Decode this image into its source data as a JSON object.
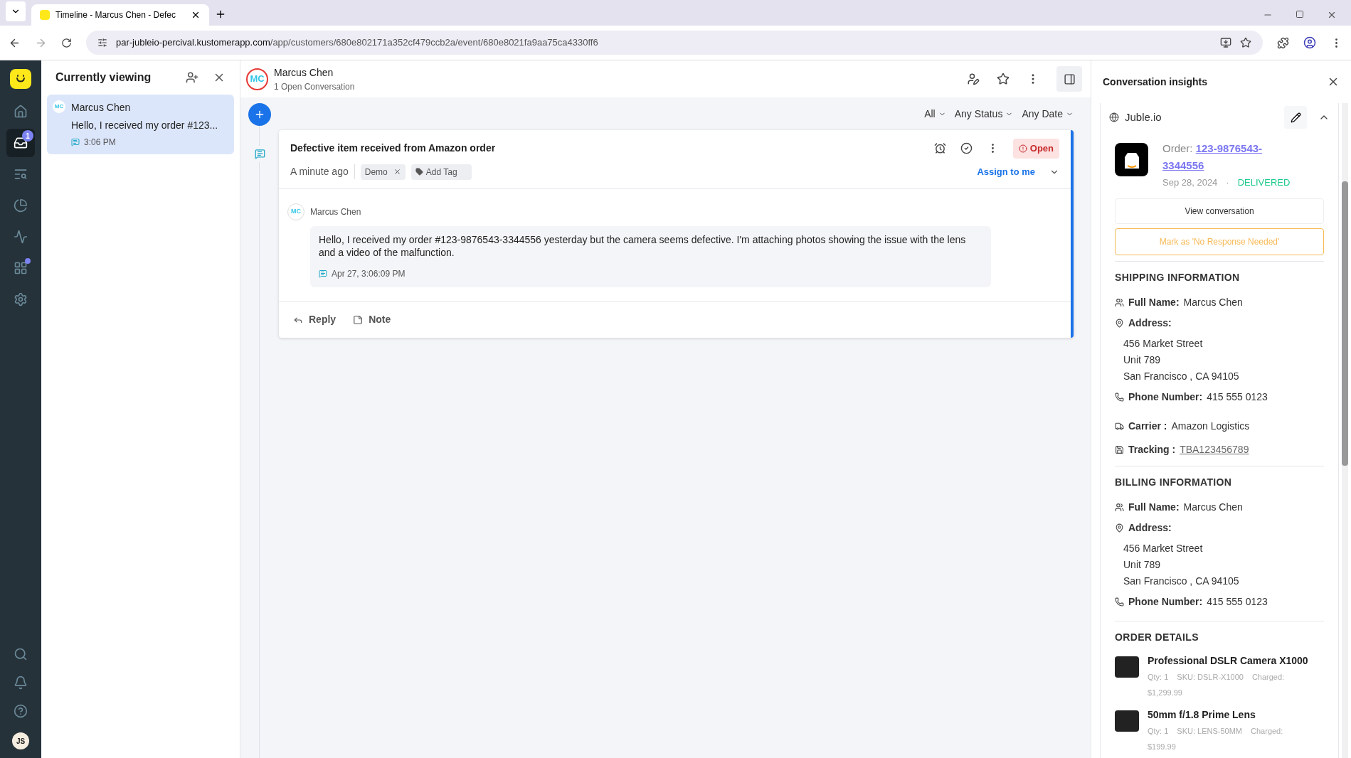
{
  "browser": {
    "tab_title": "Timeline - Marcus Chen - Defec",
    "url_host": "par-jubleio-percival.kustomerapp.com",
    "url_path": "/app/customers/680e802171a352cf479ccb2a/event/680e8021fa9aa75ca4330ff6"
  },
  "nav": {
    "items": [
      {
        "selected": false
      },
      {
        "selected": true,
        "badge": "1"
      },
      {
        "selected": false
      },
      {
        "selected": false
      },
      {
        "selected": false
      },
      {
        "selected": false,
        "dot": true
      },
      {
        "selected": false
      }
    ],
    "user_initials": "JS"
  },
  "viewing": {
    "title": "Currently viewing",
    "items": [
      {
        "initials": "MC",
        "name": "Marcus Chen",
        "preview": "Hello, I received my order #123...",
        "time": "3:06 PM",
        "selected": true
      }
    ]
  },
  "customer": {
    "initials": "MC",
    "name": "Marcus Chen",
    "subtitle": "1 Open Conversation"
  },
  "filters": [
    "All",
    "Any Status",
    "Any Date"
  ],
  "conversation": {
    "title": "Defective item received from Amazon order",
    "age": "A minute ago",
    "tags": [
      "Demo"
    ],
    "add_tag": "Add Tag",
    "status": "Open",
    "assign": "Assign to me",
    "message": {
      "initials": "MC",
      "author": "Marcus Chen",
      "body": "Hello, I received my order #123-9876543-3344556 yesterday but the camera seems defective. I'm attaching photos showing the issue with the lens and a video of the malfunction.",
      "time": "Apr 27, 3:06:09 PM"
    },
    "actions": [
      "Reply",
      "Note"
    ]
  },
  "insights": {
    "title": "Conversation insights",
    "source": "Juble.io",
    "order_label": "Order:",
    "order_number": "123-9876543-3344556",
    "order_date": "Sep 28, 2024",
    "separator": "·",
    "order_status": "DELIVERED",
    "view_button": "View conversation",
    "mark_button": "Mark as 'No Response Needed'",
    "shipping": {
      "heading": "SHIPPING INFORMATION",
      "name_label": "Full Name:",
      "name": "Marcus Chen",
      "address_label": "Address:",
      "address_lines": [
        "456 Market Street",
        "Unit 789",
        "San Francisco , CA 94105"
      ],
      "phone_label": "Phone Number:",
      "phone": "415 555 0123",
      "carrier_label": "Carrier :",
      "carrier": "Amazon Logistics",
      "tracking_label": "Tracking :",
      "tracking": "TBA123456789"
    },
    "billing": {
      "heading": "BILLING INFORMATION",
      "name_label": "Full Name:",
      "name": "Marcus Chen",
      "address_label": "Address:",
      "address_lines": [
        "456 Market Street",
        "Unit 789",
        "San Francisco , CA 94105"
      ],
      "phone_label": "Phone Number:",
      "phone": "415 555 0123"
    },
    "order_details": {
      "heading": "ORDER DETAILS",
      "items": [
        {
          "name": "Professional DSLR Camera X1000",
          "qty": "Qty: 1",
          "sku": "SKU: DSLR-X1000",
          "charged_label": "Charged:",
          "charged": "$1,299.99"
        },
        {
          "name": "50mm f/1.8 Prime Lens",
          "qty": "Qty: 1",
          "sku": "SKU: LENS-50MM",
          "charged_label": "Charged:",
          "charged": "$199.99"
        }
      ]
    }
  }
}
